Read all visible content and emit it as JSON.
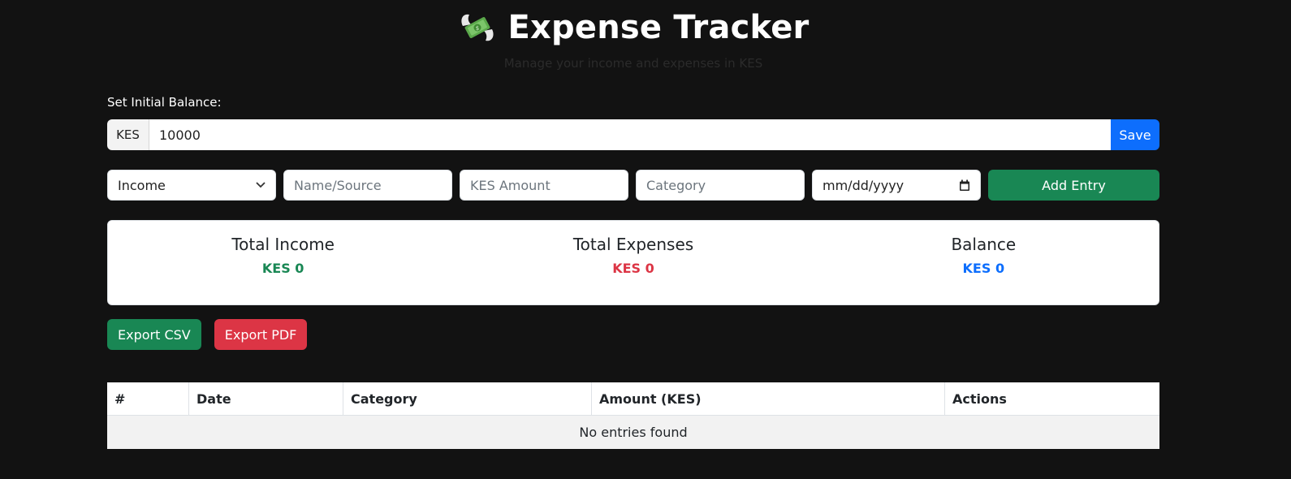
{
  "header": {
    "title": "Expense Tracker",
    "icon": "money-with-wings-icon",
    "subtitle": "Manage your income and expenses in KES"
  },
  "balance": {
    "label": "Set Initial Balance:",
    "currency": "KES",
    "value": "10000",
    "save_label": "Save"
  },
  "entry_form": {
    "type_selected": "Income",
    "name_placeholder": "Name/Source",
    "amount_placeholder": "KES Amount",
    "category_placeholder": "Category",
    "date_placeholder": "mm/dd/yyyy",
    "add_label": "Add Entry"
  },
  "summary": {
    "income": {
      "label": "Total Income",
      "value": "KES 0",
      "color": "#198754"
    },
    "expenses": {
      "label": "Total Expenses",
      "value": "KES 0",
      "color": "#dc3545"
    },
    "balance": {
      "label": "Balance",
      "value": "KES 0",
      "color": "#0d6efd"
    }
  },
  "export": {
    "csv_label": "Export CSV",
    "pdf_label": "Export PDF"
  },
  "table": {
    "columns": [
      "#",
      "Date",
      "Category",
      "Amount (KES)",
      "Actions"
    ],
    "empty_message": "No entries found"
  },
  "colors": {
    "background": "#121212",
    "primary": "#0d6efd",
    "success": "#198754",
    "danger": "#dc3545"
  }
}
